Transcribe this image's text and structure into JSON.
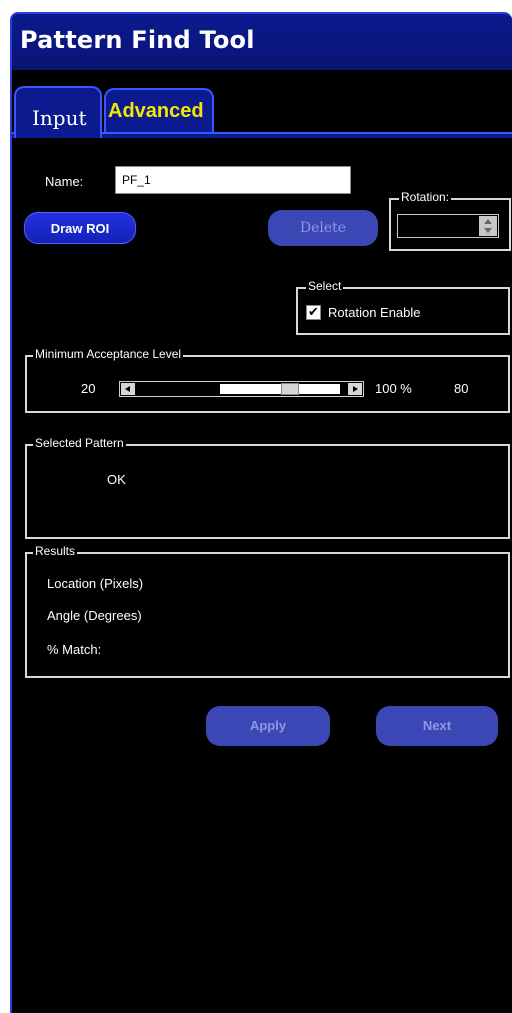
{
  "window": {
    "title": "Pattern Find Tool"
  },
  "tabs": [
    {
      "label": "Input",
      "active": true
    },
    {
      "label": "Advanced",
      "active": false
    }
  ],
  "name": {
    "label": "Name:",
    "value": "PF_1"
  },
  "buttons": {
    "draw_roi": "Draw ROI",
    "delete": "Delete",
    "apply": "Apply",
    "next": "Next"
  },
  "rotation": {
    "legend": "Rotation:",
    "value": ""
  },
  "select": {
    "legend": "Select",
    "checkbox_label": "Rotation Enable",
    "checked": true,
    "check_mark": "✔"
  },
  "min_acceptance": {
    "legend": "Minimum Acceptance Level",
    "min": "20",
    "max": "100 %",
    "current": "80",
    "level_fraction": 0.75
  },
  "selected_pattern": {
    "legend": "Selected Pattern",
    "status": "OK"
  },
  "results": {
    "legend": "Results",
    "location": "Location (Pixels)",
    "angle": "Angle (Degrees)",
    "match": "% Match:"
  },
  "colors": {
    "title_bar": "#0b1a8f",
    "background": "#000000",
    "tab_text_advanced": "#f5e600",
    "accent": "#2130e0",
    "disabled_button": "#3b47b5"
  }
}
